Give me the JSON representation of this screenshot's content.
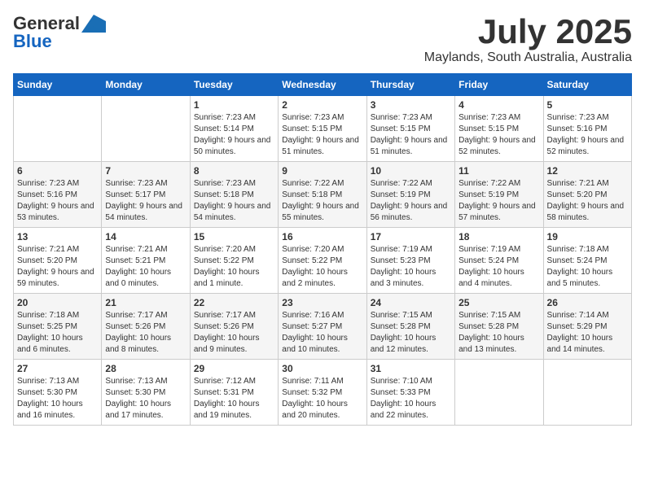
{
  "logo": {
    "part1": "General",
    "part2": "Blue"
  },
  "title": "July 2025",
  "subtitle": "Maylands, South Australia, Australia",
  "days_header": [
    "Sunday",
    "Monday",
    "Tuesday",
    "Wednesday",
    "Thursday",
    "Friday",
    "Saturday"
  ],
  "weeks": [
    [
      {
        "day": "",
        "sunrise": "",
        "sunset": "",
        "daylight": ""
      },
      {
        "day": "",
        "sunrise": "",
        "sunset": "",
        "daylight": ""
      },
      {
        "day": "1",
        "sunrise": "Sunrise: 7:23 AM",
        "sunset": "Sunset: 5:14 PM",
        "daylight": "Daylight: 9 hours and 50 minutes."
      },
      {
        "day": "2",
        "sunrise": "Sunrise: 7:23 AM",
        "sunset": "Sunset: 5:15 PM",
        "daylight": "Daylight: 9 hours and 51 minutes."
      },
      {
        "day": "3",
        "sunrise": "Sunrise: 7:23 AM",
        "sunset": "Sunset: 5:15 PM",
        "daylight": "Daylight: 9 hours and 51 minutes."
      },
      {
        "day": "4",
        "sunrise": "Sunrise: 7:23 AM",
        "sunset": "Sunset: 5:15 PM",
        "daylight": "Daylight: 9 hours and 52 minutes."
      },
      {
        "day": "5",
        "sunrise": "Sunrise: 7:23 AM",
        "sunset": "Sunset: 5:16 PM",
        "daylight": "Daylight: 9 hours and 52 minutes."
      }
    ],
    [
      {
        "day": "6",
        "sunrise": "Sunrise: 7:23 AM",
        "sunset": "Sunset: 5:16 PM",
        "daylight": "Daylight: 9 hours and 53 minutes."
      },
      {
        "day": "7",
        "sunrise": "Sunrise: 7:23 AM",
        "sunset": "Sunset: 5:17 PM",
        "daylight": "Daylight: 9 hours and 54 minutes."
      },
      {
        "day": "8",
        "sunrise": "Sunrise: 7:23 AM",
        "sunset": "Sunset: 5:18 PM",
        "daylight": "Daylight: 9 hours and 54 minutes."
      },
      {
        "day": "9",
        "sunrise": "Sunrise: 7:22 AM",
        "sunset": "Sunset: 5:18 PM",
        "daylight": "Daylight: 9 hours and 55 minutes."
      },
      {
        "day": "10",
        "sunrise": "Sunrise: 7:22 AM",
        "sunset": "Sunset: 5:19 PM",
        "daylight": "Daylight: 9 hours and 56 minutes."
      },
      {
        "day": "11",
        "sunrise": "Sunrise: 7:22 AM",
        "sunset": "Sunset: 5:19 PM",
        "daylight": "Daylight: 9 hours and 57 minutes."
      },
      {
        "day": "12",
        "sunrise": "Sunrise: 7:21 AM",
        "sunset": "Sunset: 5:20 PM",
        "daylight": "Daylight: 9 hours and 58 minutes."
      }
    ],
    [
      {
        "day": "13",
        "sunrise": "Sunrise: 7:21 AM",
        "sunset": "Sunset: 5:20 PM",
        "daylight": "Daylight: 9 hours and 59 minutes."
      },
      {
        "day": "14",
        "sunrise": "Sunrise: 7:21 AM",
        "sunset": "Sunset: 5:21 PM",
        "daylight": "Daylight: 10 hours and 0 minutes."
      },
      {
        "day": "15",
        "sunrise": "Sunrise: 7:20 AM",
        "sunset": "Sunset: 5:22 PM",
        "daylight": "Daylight: 10 hours and 1 minute."
      },
      {
        "day": "16",
        "sunrise": "Sunrise: 7:20 AM",
        "sunset": "Sunset: 5:22 PM",
        "daylight": "Daylight: 10 hours and 2 minutes."
      },
      {
        "day": "17",
        "sunrise": "Sunrise: 7:19 AM",
        "sunset": "Sunset: 5:23 PM",
        "daylight": "Daylight: 10 hours and 3 minutes."
      },
      {
        "day": "18",
        "sunrise": "Sunrise: 7:19 AM",
        "sunset": "Sunset: 5:24 PM",
        "daylight": "Daylight: 10 hours and 4 minutes."
      },
      {
        "day": "19",
        "sunrise": "Sunrise: 7:18 AM",
        "sunset": "Sunset: 5:24 PM",
        "daylight": "Daylight: 10 hours and 5 minutes."
      }
    ],
    [
      {
        "day": "20",
        "sunrise": "Sunrise: 7:18 AM",
        "sunset": "Sunset: 5:25 PM",
        "daylight": "Daylight: 10 hours and 6 minutes."
      },
      {
        "day": "21",
        "sunrise": "Sunrise: 7:17 AM",
        "sunset": "Sunset: 5:26 PM",
        "daylight": "Daylight: 10 hours and 8 minutes."
      },
      {
        "day": "22",
        "sunrise": "Sunrise: 7:17 AM",
        "sunset": "Sunset: 5:26 PM",
        "daylight": "Daylight: 10 hours and 9 minutes."
      },
      {
        "day": "23",
        "sunrise": "Sunrise: 7:16 AM",
        "sunset": "Sunset: 5:27 PM",
        "daylight": "Daylight: 10 hours and 10 minutes."
      },
      {
        "day": "24",
        "sunrise": "Sunrise: 7:15 AM",
        "sunset": "Sunset: 5:28 PM",
        "daylight": "Daylight: 10 hours and 12 minutes."
      },
      {
        "day": "25",
        "sunrise": "Sunrise: 7:15 AM",
        "sunset": "Sunset: 5:28 PM",
        "daylight": "Daylight: 10 hours and 13 minutes."
      },
      {
        "day": "26",
        "sunrise": "Sunrise: 7:14 AM",
        "sunset": "Sunset: 5:29 PM",
        "daylight": "Daylight: 10 hours and 14 minutes."
      }
    ],
    [
      {
        "day": "27",
        "sunrise": "Sunrise: 7:13 AM",
        "sunset": "Sunset: 5:30 PM",
        "daylight": "Daylight: 10 hours and 16 minutes."
      },
      {
        "day": "28",
        "sunrise": "Sunrise: 7:13 AM",
        "sunset": "Sunset: 5:30 PM",
        "daylight": "Daylight: 10 hours and 17 minutes."
      },
      {
        "day": "29",
        "sunrise": "Sunrise: 7:12 AM",
        "sunset": "Sunset: 5:31 PM",
        "daylight": "Daylight: 10 hours and 19 minutes."
      },
      {
        "day": "30",
        "sunrise": "Sunrise: 7:11 AM",
        "sunset": "Sunset: 5:32 PM",
        "daylight": "Daylight: 10 hours and 20 minutes."
      },
      {
        "day": "31",
        "sunrise": "Sunrise: 7:10 AM",
        "sunset": "Sunset: 5:33 PM",
        "daylight": "Daylight: 10 hours and 22 minutes."
      },
      {
        "day": "",
        "sunrise": "",
        "sunset": "",
        "daylight": ""
      },
      {
        "day": "",
        "sunrise": "",
        "sunset": "",
        "daylight": ""
      }
    ]
  ]
}
